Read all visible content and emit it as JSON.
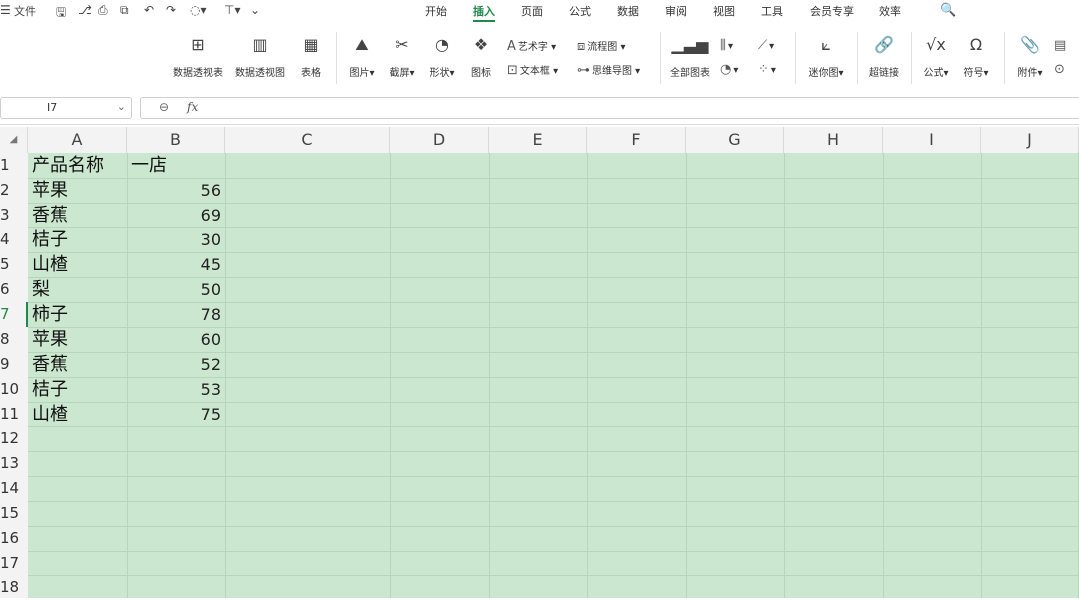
{
  "menubar": {
    "file_label": "文件",
    "tabs": [
      "开始",
      "插入",
      "页面",
      "公式",
      "数据",
      "审阅",
      "视图",
      "工具",
      "会员专享",
      "效率"
    ],
    "active_tab": "插入"
  },
  "ribbon": {
    "pivot_table": "数据透视表",
    "pivot_chart": "数据透视图",
    "table": "表格",
    "picture": "图片",
    "screenshot": "截屏",
    "shape": "形状",
    "icon": "图标",
    "wordart": "艺术字",
    "textbox": "文本框",
    "flowchart": "流程图",
    "mindmap": "思维导图",
    "all_charts": "全部图表",
    "sparkline": "迷你图",
    "hyperlink": "超链接",
    "formula": "公式",
    "symbol": "符号",
    "attachment": "附件"
  },
  "formula_bar": {
    "cell_ref": "I7",
    "fx": "fx",
    "value": ""
  },
  "grid": {
    "columns": [
      "A",
      "B",
      "C",
      "D",
      "E",
      "F",
      "G",
      "H",
      "I",
      "J"
    ],
    "rows": [
      "1",
      "2",
      "3",
      "4",
      "5",
      "6",
      "7",
      "8",
      "9",
      "10",
      "11",
      "12",
      "13",
      "14",
      "15",
      "16",
      "17",
      "18"
    ],
    "header": {
      "a1": "产品名称",
      "b1": "一店"
    },
    "data": [
      {
        "name": "苹果",
        "value": "56"
      },
      {
        "name": "香蕉",
        "value": "69"
      },
      {
        "name": "桔子",
        "value": "30"
      },
      {
        "name": "山楂",
        "value": "45"
      },
      {
        "name": "梨",
        "value": "50"
      },
      {
        "name": "柿子",
        "value": "78"
      },
      {
        "name": "苹果",
        "value": "60"
      },
      {
        "name": "香蕉",
        "value": "52"
      },
      {
        "name": "桔子",
        "value": "53"
      },
      {
        "name": "山楂",
        "value": "75"
      }
    ]
  },
  "colors": {
    "grid_fill": "#cce7cf",
    "accent": "#1f8a4c"
  }
}
